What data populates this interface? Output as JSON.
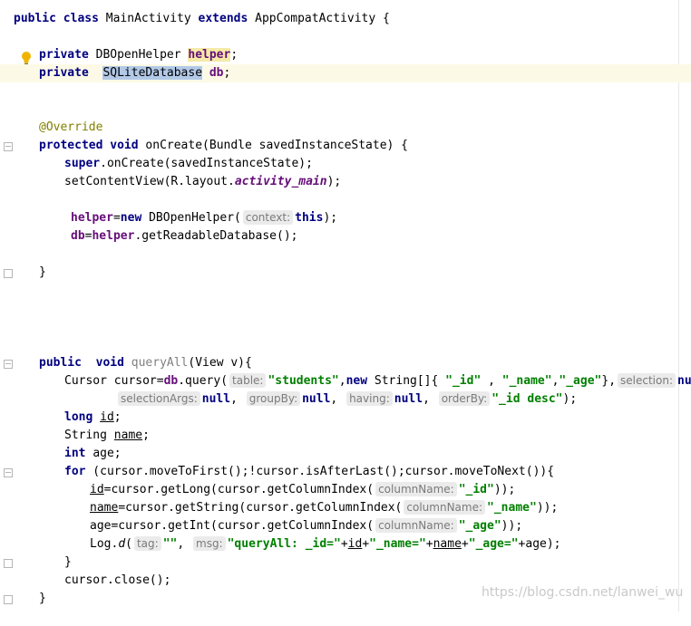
{
  "code": {
    "class_decl": {
      "kw1": "public",
      "kw2": "class",
      "name": "MainActivity",
      "kw3": "extends",
      "super": "AppCompatActivity",
      "brace": "{"
    },
    "field1": {
      "kw": "private",
      "type": "DBOpenHelper",
      "name": "helper",
      "semi": ";"
    },
    "field2": {
      "kw": "private",
      "type": "SQLiteDatabase",
      "name": "db",
      "semi": ";"
    },
    "annotation": "@Override",
    "oncreate": {
      "kw1": "protected",
      "kw2": "void",
      "sig": "onCreate(Bundle savedInstanceState) {"
    },
    "super_call": {
      "kw": "super",
      "rest": ".onCreate(savedInstanceState);"
    },
    "setcontent": {
      "pre": "setContentView(R.layout.",
      "field": "activity_main",
      "post": ");"
    },
    "helper_assign": {
      "field": "helper",
      "pre": "=",
      "kw": "new",
      "ctor": " DBOpenHelper(",
      "hint": "context:",
      "this_kw": "this",
      "post": ");"
    },
    "db_assign": {
      "field1": "db",
      "eq": "=",
      "field2": "helper",
      "post": ".getReadableDatabase();"
    },
    "close_brace": "}",
    "queryall": {
      "kw1": "public",
      "kw2": "void",
      "name": "queryAll",
      "sig": "(View v){"
    },
    "cursor_line": {
      "pre": "Cursor cursor=",
      "field": "db",
      "call": ".query(",
      "hint_table": "table:",
      "s_students": "\"students\"",
      "comma1": ",",
      "new_kw": "new",
      "arr": " String[]{ ",
      "s_id": "\"_id\"",
      "sep1": " , ",
      "s_name": "\"_name\"",
      "sep2": ",",
      "s_age": "\"_age\"",
      "close_arr": "},",
      "hint_selection": "selection:",
      "null1": "null",
      "comma2": ","
    },
    "cursor_line2": {
      "hint_args": "selectionArgs:",
      "null2": "null",
      "c1": ",",
      "hint_group": "groupBy:",
      "null3": "null",
      "c2": ",",
      "hint_having": "having:",
      "null4": "null",
      "c3": ",",
      "hint_order": "orderBy:",
      "s_order": "\"_id desc\"",
      "end": ");"
    },
    "long_decl": {
      "kw": "long",
      "name": "id",
      "semi": ";"
    },
    "string_decl": {
      "type": "String",
      "name": "name",
      "semi": ";"
    },
    "int_decl": {
      "kw": "int",
      "name": "age",
      "semi": ";"
    },
    "for_line": {
      "kw": "for",
      "rest": " (cursor.moveToFirst();!cursor.isAfterLast();cursor.moveToNext()){"
    },
    "id_line": {
      "var": "id",
      "pre": "=cursor.getLong(cursor.getColumnIndex(",
      "hint": "columnName:",
      "str": "\"_id\"",
      "post": "));"
    },
    "name_line": {
      "var": "name",
      "pre": "=cursor.getString(cursor.getColumnIndex(",
      "hint": "columnName:",
      "str": "\"_name\"",
      "post": "));"
    },
    "age_line": {
      "var": "age",
      "pre": "=cursor.getInt(cursor.getColumnIndex(",
      "hint": "columnName:",
      "str": "\"_age\"",
      "post": "));"
    },
    "log_line": {
      "pre": "Log.",
      "method": "d",
      "open": "(",
      "hint_tag": "tag:",
      "s_empty": "\"\"",
      "comma": ",",
      "hint_msg": "msg:",
      "s_q": "\"queryAll: _id=\"",
      "p1": "+",
      "v_id": "id",
      "p2": "+",
      "s_n": "\"_name=\"",
      "p3": "+",
      "v_name": "name",
      "p4": "+",
      "s_a": "\"_age=\"",
      "p5": "+",
      "v_age": "age",
      "end": ");"
    },
    "cursor_close": "cursor.close();"
  },
  "watermark": "https://blog.csdn.net/lanwei_wu",
  "colors": {
    "keyword": "#000080",
    "string": "#008000",
    "field": "#660e7a",
    "annotation": "#808000",
    "selection": "#b2c9e8",
    "caret_row": "#fcfae6"
  }
}
